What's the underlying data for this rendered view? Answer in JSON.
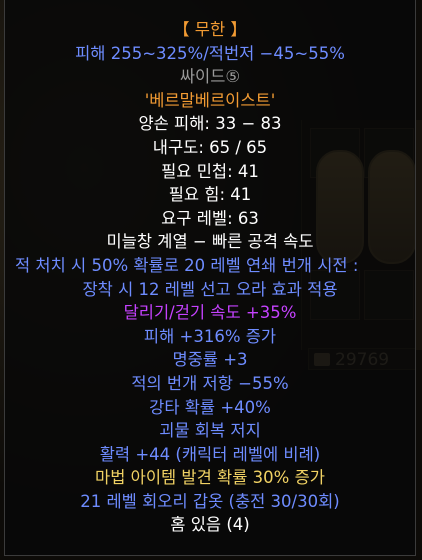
{
  "gold": {
    "amount": "29769"
  },
  "tooltip": {
    "lines": [
      {
        "text": "【 무한 】",
        "color": "orange"
      },
      {
        "text": "피해 255~325%/적번저 −45~55%",
        "color": "blue"
      },
      {
        "text": "싸이드⑤",
        "color": "gray"
      },
      {
        "text": "'베르말베르이스트'",
        "color": "orange"
      },
      {
        "text": "양손 피해: 33 − 83",
        "color": "white",
        "value": "33 − 83"
      },
      {
        "text": "내구도: 65 / 65",
        "color": "white"
      },
      {
        "text": "필요 민첩: 41",
        "color": "white"
      },
      {
        "text": "필요 힘: 41",
        "color": "white"
      },
      {
        "text": "요구 레벨: 63",
        "color": "white"
      },
      {
        "text": "미늘창 계열 − 빠른 공격 속도",
        "color": "white"
      },
      {
        "text": "적 처치 시 50% 확률로 20 레벨 연쇄 번개 시전 :",
        "color": "blue"
      },
      {
        "text": "장착 시 12 레벨 선고 오라 효과 적용",
        "color": "blue"
      },
      {
        "text": "달리기/걷기 속도 +35%",
        "color": "magenta"
      },
      {
        "text": "피해 +316% 증가",
        "color": "blue"
      },
      {
        "text": "명중률 +3",
        "color": "blue"
      },
      {
        "text": "적의 번개 저항 −55%",
        "color": "blue"
      },
      {
        "text": "강타 확률 +40%",
        "color": "blue"
      },
      {
        "text": "괴물 회복 저지",
        "color": "blue"
      },
      {
        "text": "활력 +44 (캐릭터 레벨에 비례)",
        "color": "blue"
      },
      {
        "text": "마법 아이템 발견 확률 30% 증가",
        "color": "yellow"
      },
      {
        "text": "21 레벨 회오리 갑옷 (충전 30/30회)",
        "color": "blue"
      },
      {
        "text": "홈 있음 (4)",
        "color": "white"
      }
    ]
  }
}
